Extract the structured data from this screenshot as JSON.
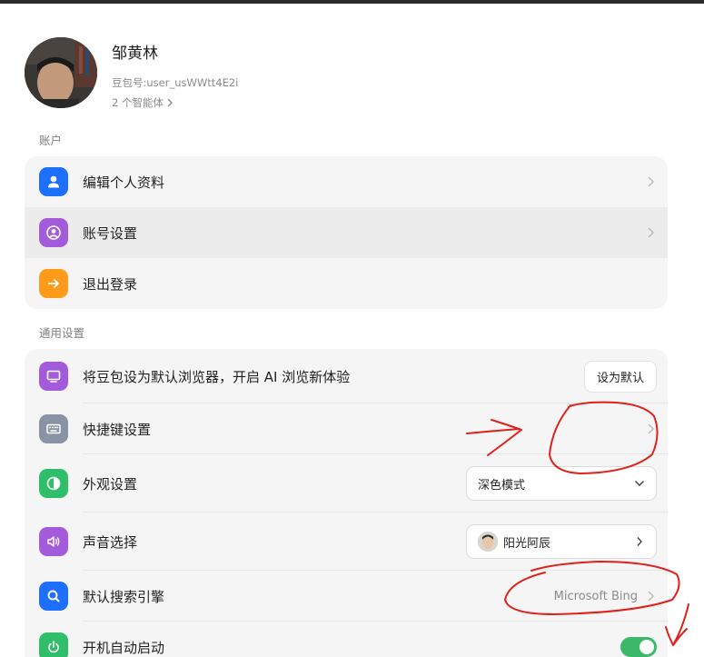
{
  "profile": {
    "name": "邹黄林",
    "id_text": "豆包号:user_usWWtt4E2i",
    "agents_link": "2 个智能体"
  },
  "account": {
    "section_title": "账户",
    "items": [
      {
        "label": "编辑个人资料",
        "icon": "user-icon",
        "color": "#1f6fff"
      },
      {
        "label": "账号设置",
        "icon": "account-circle-icon",
        "color": "#a35bdc"
      },
      {
        "label": "退出登录",
        "icon": "arrow-right-icon",
        "color": "#ff9a1a"
      }
    ]
  },
  "general": {
    "section_title": "通用设置",
    "default_browser": {
      "label": "将豆包设为默认浏览器，开启 AI 浏览新体验",
      "button": "设为默认",
      "icon": "monitor-icon",
      "color": "#a35bdc"
    },
    "shortcuts": {
      "label": "快捷键设置",
      "icon": "keyboard-icon",
      "color": "#8a93a6"
    },
    "appearance": {
      "label": "外观设置",
      "value": "深色模式",
      "icon": "contrast-icon",
      "color": "#2fbf6a"
    },
    "voice": {
      "label": "声音选择",
      "value": "阳光阿辰",
      "icon": "speaker-icon",
      "color": "#a35bdc"
    },
    "search_engine": {
      "label": "默认搜索引擎",
      "value": "Microsoft Bing",
      "icon": "search-icon",
      "color": "#1f6fff"
    },
    "autostart": {
      "label": "开机自动启动",
      "enabled": true,
      "icon": "power-icon",
      "color": "#2fbf6a"
    }
  },
  "annotation_color": "#e0201b"
}
